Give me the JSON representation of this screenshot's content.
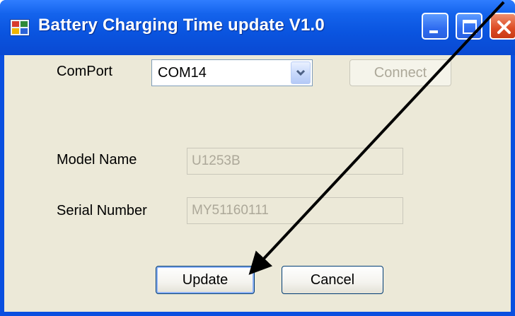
{
  "window": {
    "title": "Battery Charging Time update V1.0"
  },
  "form": {
    "comport_label": "ComPort",
    "comport_value": "COM14",
    "connect_label": "Connect",
    "model_name_label": "Model Name",
    "model_name_value": "U1253B",
    "serial_number_label": "Serial Number",
    "serial_number_value": "MY51160111",
    "update_label": "Update",
    "cancel_label": "Cancel"
  },
  "colors": {
    "titlebar": "#0a54df",
    "client_bg": "#ece9d8",
    "close_button": "#dc4b24",
    "annotation_arrow": "#000000"
  },
  "icons": [
    "app-icon",
    "minimize-icon",
    "maximize-icon",
    "close-icon",
    "chevron-down-icon"
  ]
}
